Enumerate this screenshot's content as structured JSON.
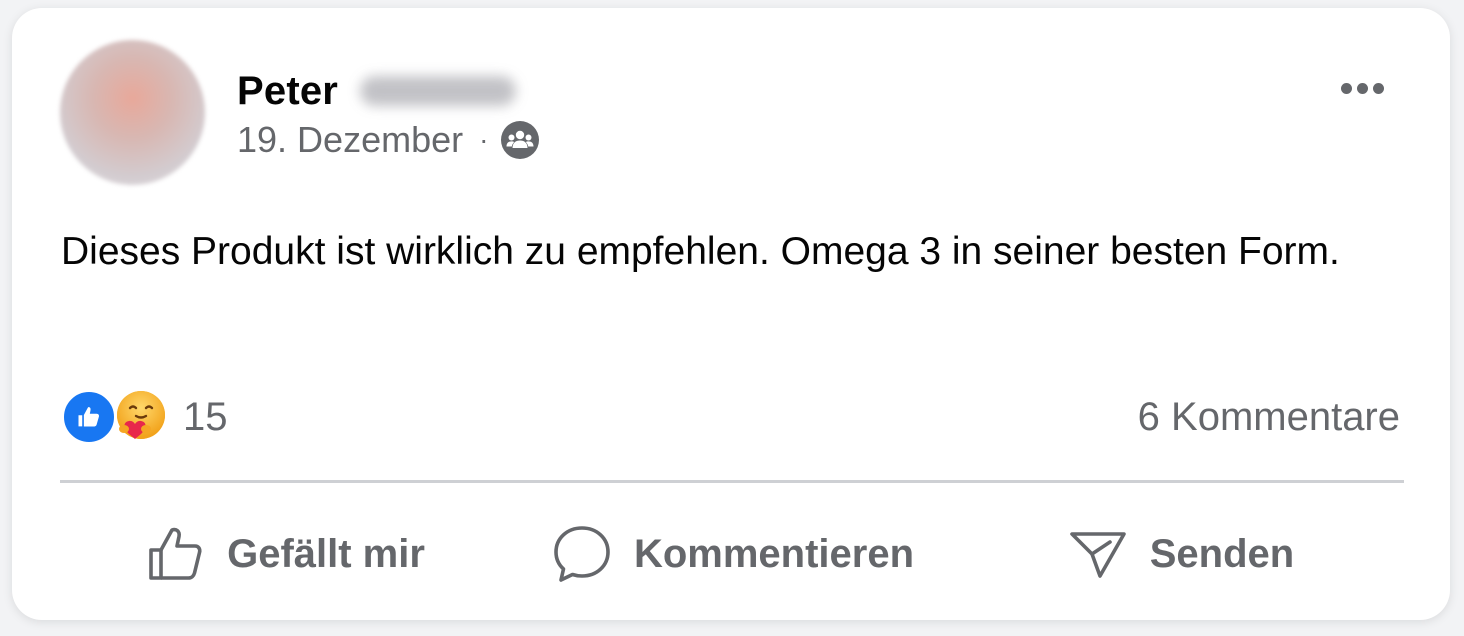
{
  "post": {
    "author_first_name": "Peter",
    "date": "19. Dezember",
    "separator": "·",
    "audience_icon": "friends-icon",
    "text": "Dieses Produkt ist wirklich zu empfehlen. Omega 3 in seiner besten Form.",
    "reactions": {
      "types": [
        "like-icon",
        "care-icon"
      ],
      "count": "15"
    },
    "comments_label": "6 Kommentare"
  },
  "actions": {
    "like_label": "Gefällt mir",
    "comment_label": "Kommentieren",
    "share_label": "Senden"
  },
  "colors": {
    "like_blue": "#1877f2",
    "secondary_text": "#65676b",
    "divider": "#ced0d4"
  }
}
